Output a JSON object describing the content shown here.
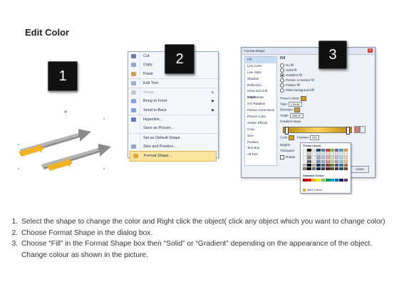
{
  "title": "Edit Color",
  "badges": [
    "1",
    "2",
    "3"
  ],
  "context_menu": {
    "items": [
      {
        "label": "Cut",
        "underline": "t",
        "icon": "scissors-icon",
        "state": "normal"
      },
      {
        "label": "Copy",
        "icon": "copy-icon",
        "state": "normal"
      },
      {
        "label": "Paste",
        "icon": "paste-icon",
        "state": "normal"
      },
      {
        "label": "Edit Text",
        "icon": "edit-text-icon",
        "state": "sep"
      },
      {
        "label": "Group",
        "icon": "group-icon",
        "state": "disabled",
        "submenu": true
      },
      {
        "label": "Bring to Front",
        "icon": "bring-front-icon",
        "state": "normal",
        "submenu": true
      },
      {
        "label": "Send to Back",
        "icon": "send-back-icon",
        "state": "normal",
        "submenu": true
      },
      {
        "label": "Hyperlink...",
        "icon": "hyperlink-icon",
        "state": "sep"
      },
      {
        "label": "Save as Picture...",
        "icon": "",
        "state": "normal"
      },
      {
        "label": "Set as Default Shape",
        "icon": "",
        "state": "sep"
      },
      {
        "label": "Size and Position...",
        "icon": "size-icon",
        "state": "normal"
      },
      {
        "label": "Format Shape...",
        "icon": "format-icon",
        "state": "highlight"
      }
    ]
  },
  "dialog": {
    "title": "Format Shape",
    "close_label": "Close",
    "sidebar": [
      "Fill",
      "Line Color",
      "Line Style",
      "Shadow",
      "Reflection",
      "Glow and Soft Edges",
      "3-D Format",
      "3-D Rotation",
      "Picture Corrections",
      "Picture Color",
      "Artistic Effects",
      "Crop",
      "Size",
      "Position",
      "Text Box",
      "Alt Text"
    ],
    "section_title": "Fill",
    "fill_options": [
      "No fill",
      "Solid fill",
      "Gradient fill",
      "Picture or texture fill",
      "Pattern fill",
      "Slide background fill"
    ],
    "selected_fill": "Gradient fill",
    "preset_label": "Preset colors:",
    "type_label": "Type:",
    "type_value": "Linear",
    "direction_label": "Direction:",
    "angle_label": "Angle:",
    "angle_value": "359.9°",
    "stops_label": "Gradient stops",
    "color_label": "Color",
    "position_label": "Position:",
    "position_value": "0%",
    "brightness_label": "Brightn",
    "transparency_label": "Transpare",
    "rotate_label": "Rotate"
  },
  "color_popup": {
    "theme_label": "Theme Colors",
    "standard_label": "Standard Colors",
    "more_label": "More Colors...",
    "theme_row": [
      "#ffffff",
      "#000000",
      "#eeece1",
      "#1f497d",
      "#4f81bd",
      "#c0504d",
      "#9bbb59",
      "#8064a2",
      "#4bacc6",
      "#f79646"
    ],
    "standard_row": [
      "#c00000",
      "#ff0000",
      "#ffc000",
      "#ffff00",
      "#92d050",
      "#00b050",
      "#00b0f0",
      "#0070c0",
      "#002060",
      "#7030a0"
    ]
  },
  "instructions": [
    "Select the shape to change the color and Right click the object( click any object which you want to change color)",
    "Choose Format Shape in the dialog box.",
    "Choose “Fill” in the Format Shape box then “Solid” or “Gradient” depending on the appearance of the object. Change colour as shown in the picture."
  ],
  "colors": {
    "accent": "#f0b323",
    "arrow_gray": "#8c8c8c",
    "badge": "#111111"
  }
}
